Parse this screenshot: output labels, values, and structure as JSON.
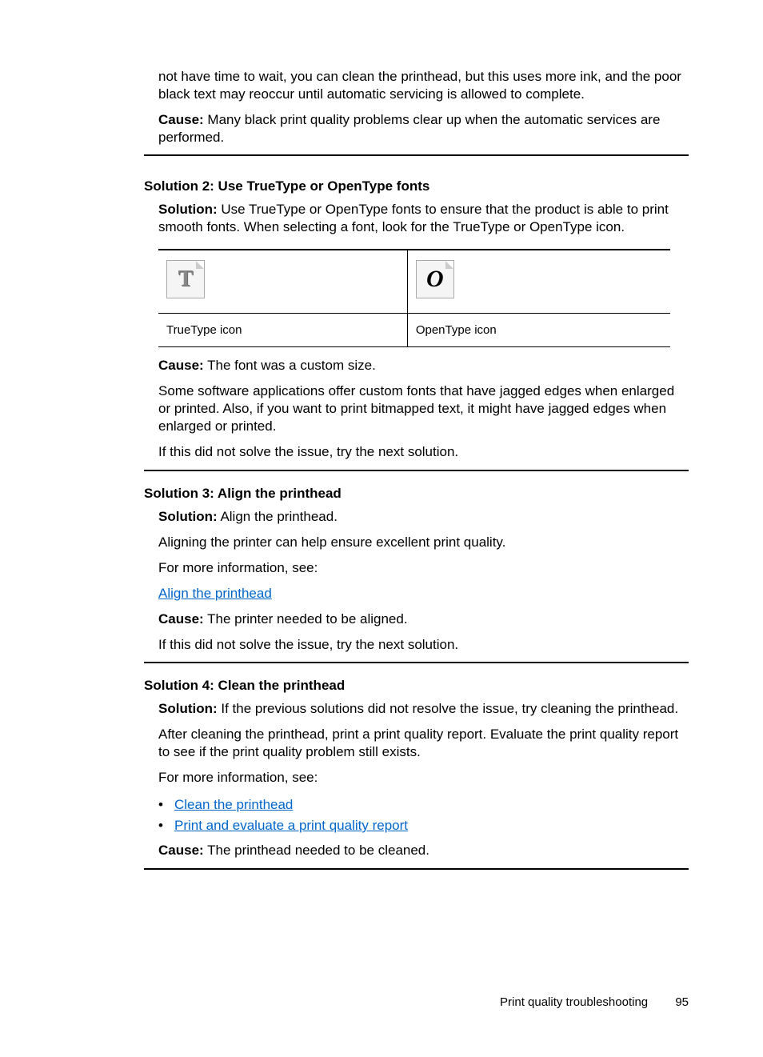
{
  "intro": {
    "paragraph1": "not have time to wait, you can clean the printhead, but this uses more ink, and the poor black text may reoccur until automatic servicing is allowed to complete.",
    "cause_label": "Cause:",
    "cause_text": "   Many black print quality problems clear up when the automatic services are performed."
  },
  "solution2": {
    "heading": "Solution 2: Use TrueType or OpenType fonts",
    "solution_label": "Solution:",
    "solution_text": "   Use TrueType or OpenType fonts to ensure that the product is able to print smooth fonts. When selecting a font, look for the TrueType or OpenType icon.",
    "truetype_label": "TrueType icon",
    "opentype_label": "OpenType icon",
    "cause_label": "Cause:",
    "cause_text": "   The font was a custom size.",
    "paragraph1": "Some software applications offer custom fonts that have jagged edges when enlarged or printed. Also, if you want to print bitmapped text, it might have jagged edges when enlarged or printed.",
    "paragraph2": "If this did not solve the issue, try the next solution."
  },
  "solution3": {
    "heading": "Solution 3: Align the printhead",
    "solution_label": "Solution:",
    "solution_text": "   Align the printhead.",
    "paragraph1": "Aligning the printer can help ensure excellent print quality.",
    "paragraph2": "For more information, see:",
    "link": "Align the printhead",
    "cause_label": "Cause:",
    "cause_text": "   The printer needed to be aligned.",
    "paragraph3": "If this did not solve the issue, try the next solution."
  },
  "solution4": {
    "heading": "Solution 4: Clean the printhead",
    "solution_label": "Solution:",
    "solution_text": "   If the previous solutions did not resolve the issue, try cleaning the printhead.",
    "paragraph1": "After cleaning the printhead, print a print quality report. Evaluate the print quality report to see if the print quality problem still exists.",
    "paragraph2": "For more information, see:",
    "link1": "Clean the printhead",
    "link2": "Print and evaluate a print quality report",
    "cause_label": "Cause:",
    "cause_text": "   The printhead needed to be cleaned."
  },
  "footer": {
    "section": "Print quality troubleshooting",
    "page": "95"
  }
}
